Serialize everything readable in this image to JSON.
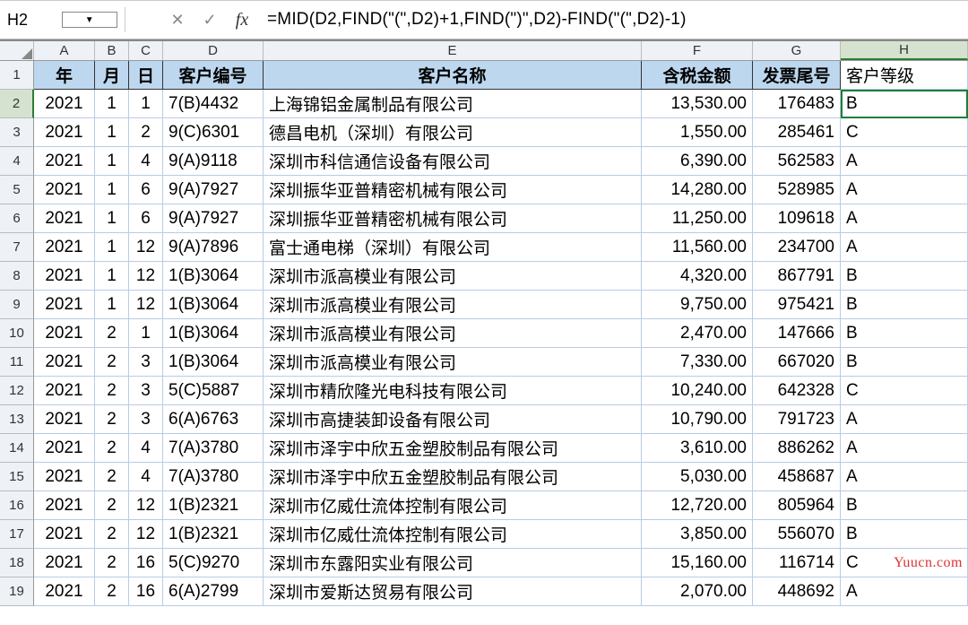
{
  "name_box": "H2",
  "formula": "=MID(D2,FIND(\"(\",D2)+1,FIND(\")\",D2)-FIND(\"(\",D2)-1)",
  "columns": [
    "A",
    "B",
    "C",
    "D",
    "E",
    "F",
    "G",
    "H"
  ],
  "active_col": "H",
  "active_row": 2,
  "headers": {
    "A": "年",
    "B": "月",
    "C": "日",
    "D": "客户编号",
    "E": "客户名称",
    "F": "含税金额",
    "G": "发票尾号",
    "H": "客户等级"
  },
  "rows": [
    {
      "n": 2,
      "A": "2021",
      "B": "1",
      "C": "1",
      "D": "7(B)4432",
      "E": "上海锦铝金属制品有限公司",
      "F": "13,530.00",
      "G": "176483",
      "H": "B"
    },
    {
      "n": 3,
      "A": "2021",
      "B": "1",
      "C": "2",
      "D": "9(C)6301",
      "E": "德昌电机（深圳）有限公司",
      "F": "1,550.00",
      "G": "285461",
      "H": "C"
    },
    {
      "n": 4,
      "A": "2021",
      "B": "1",
      "C": "4",
      "D": "9(A)9118",
      "E": "深圳市科信通信设备有限公司",
      "F": "6,390.00",
      "G": "562583",
      "H": "A"
    },
    {
      "n": 5,
      "A": "2021",
      "B": "1",
      "C": "6",
      "D": "9(A)7927",
      "E": "深圳振华亚普精密机械有限公司",
      "F": "14,280.00",
      "G": "528985",
      "H": "A"
    },
    {
      "n": 6,
      "A": "2021",
      "B": "1",
      "C": "6",
      "D": "9(A)7927",
      "E": "深圳振华亚普精密机械有限公司",
      "F": "11,250.00",
      "G": "109618",
      "H": "A"
    },
    {
      "n": 7,
      "A": "2021",
      "B": "1",
      "C": "12",
      "D": "9(A)7896",
      "E": "富士通电梯（深圳）有限公司",
      "F": "11,560.00",
      "G": "234700",
      "H": "A"
    },
    {
      "n": 8,
      "A": "2021",
      "B": "1",
      "C": "12",
      "D": "1(B)3064",
      "E": "深圳市派高模业有限公司",
      "F": "4,320.00",
      "G": "867791",
      "H": "B"
    },
    {
      "n": 9,
      "A": "2021",
      "B": "1",
      "C": "12",
      "D": "1(B)3064",
      "E": "深圳市派高模业有限公司",
      "F": "9,750.00",
      "G": "975421",
      "H": "B"
    },
    {
      "n": 10,
      "A": "2021",
      "B": "2",
      "C": "1",
      "D": "1(B)3064",
      "E": "深圳市派高模业有限公司",
      "F": "2,470.00",
      "G": "147666",
      "H": "B"
    },
    {
      "n": 11,
      "A": "2021",
      "B": "2",
      "C": "3",
      "D": "1(B)3064",
      "E": "深圳市派高模业有限公司",
      "F": "7,330.00",
      "G": "667020",
      "H": "B"
    },
    {
      "n": 12,
      "A": "2021",
      "B": "2",
      "C": "3",
      "D": "5(C)5887",
      "E": "深圳市精欣隆光电科技有限公司",
      "F": "10,240.00",
      "G": "642328",
      "H": "C"
    },
    {
      "n": 13,
      "A": "2021",
      "B": "2",
      "C": "3",
      "D": "6(A)6763",
      "E": "深圳市高捷装卸设备有限公司",
      "F": "10,790.00",
      "G": "791723",
      "H": "A"
    },
    {
      "n": 14,
      "A": "2021",
      "B": "2",
      "C": "4",
      "D": "7(A)3780",
      "E": "深圳市泽宇中欣五金塑胶制品有限公司",
      "F": "3,610.00",
      "G": "886262",
      "H": "A"
    },
    {
      "n": 15,
      "A": "2021",
      "B": "2",
      "C": "4",
      "D": "7(A)3780",
      "E": "深圳市泽宇中欣五金塑胶制品有限公司",
      "F": "5,030.00",
      "G": "458687",
      "H": "A"
    },
    {
      "n": 16,
      "A": "2021",
      "B": "2",
      "C": "12",
      "D": "1(B)2321",
      "E": "深圳市亿威仕流体控制有限公司",
      "F": "12,720.00",
      "G": "805964",
      "H": "B"
    },
    {
      "n": 17,
      "A": "2021",
      "B": "2",
      "C": "12",
      "D": "1(B)2321",
      "E": "深圳市亿威仕流体控制有限公司",
      "F": "3,850.00",
      "G": "556070",
      "H": "B"
    },
    {
      "n": 18,
      "A": "2021",
      "B": "2",
      "C": "16",
      "D": "5(C)9270",
      "E": "深圳市东露阳实业有限公司",
      "F": "15,160.00",
      "G": "116714",
      "H": "C"
    },
    {
      "n": 19,
      "A": "2021",
      "B": "2",
      "C": "16",
      "D": "6(A)2799",
      "E": "深圳市爱斯达贸易有限公司",
      "F": "2,070.00",
      "G": "448692",
      "H": "A"
    }
  ],
  "watermark": "Yuucn.com"
}
